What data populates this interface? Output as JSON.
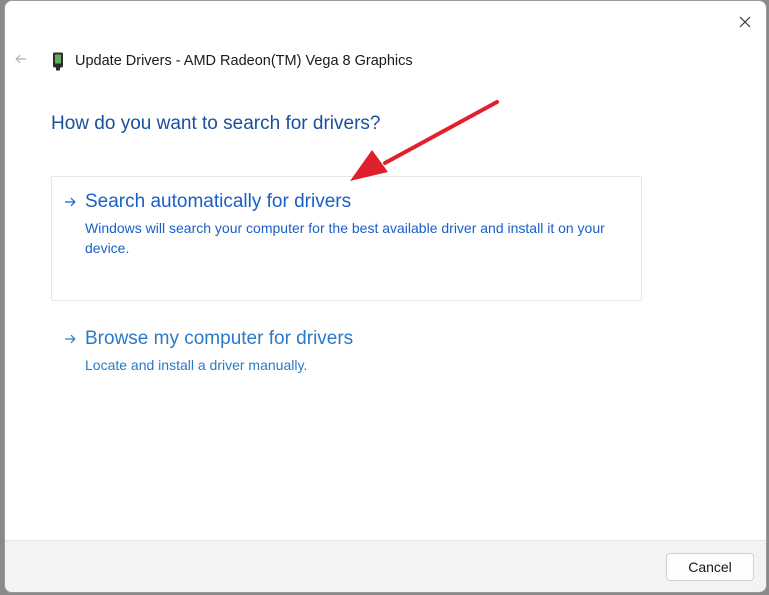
{
  "window": {
    "title": "Update Drivers - AMD Radeon(TM) Vega 8 Graphics"
  },
  "icons": {
    "back": "back-arrow-icon",
    "close": "close-icon",
    "device": "display-adapter-icon",
    "option_arrow": "right-arrow-icon",
    "annotation": "red-pointer-arrow"
  },
  "main": {
    "heading": "How do you want to search for drivers?",
    "options": [
      {
        "title": "Search automatically for drivers",
        "description": "Windows will search your computer for the best available driver and install it on your device."
      },
      {
        "title": "Browse my computer for drivers",
        "description": "Locate and install a driver manually."
      }
    ]
  },
  "footer": {
    "cancel_label": "Cancel"
  },
  "colors": {
    "heading": "#1a4f9c",
    "link": "#1a5fc8",
    "annotation_arrow": "#e0202a"
  }
}
